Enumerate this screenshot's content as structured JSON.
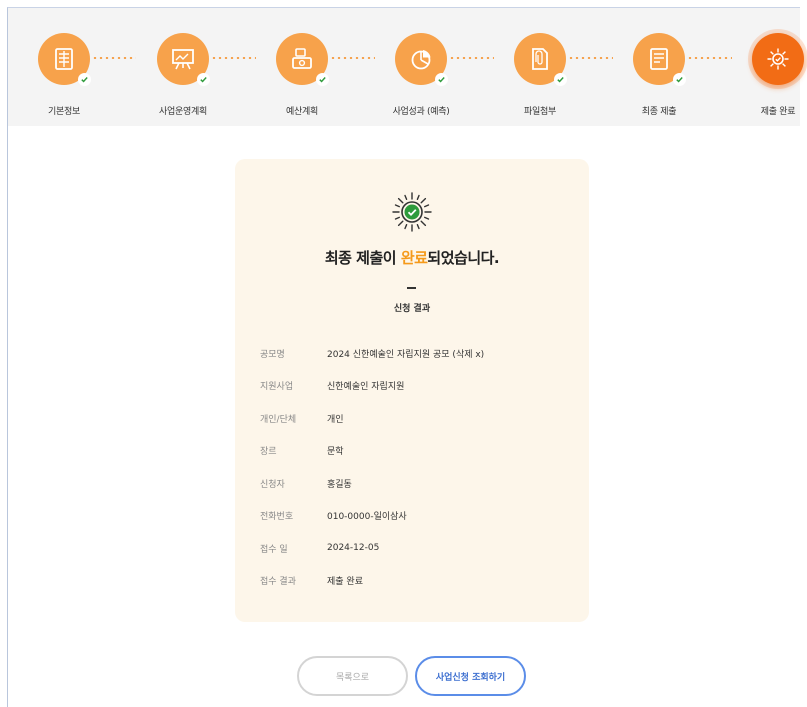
{
  "steps": [
    {
      "label": "기본정보",
      "icon": "form-grid-icon"
    },
    {
      "label": "사업운영계획",
      "icon": "presentation-board-icon"
    },
    {
      "label": "예산계획",
      "icon": "money-stack-icon"
    },
    {
      "label": "사업성과 (예측)",
      "icon": "pie-chart-icon"
    },
    {
      "label": "파일첨부",
      "icon": "paperclip-document-icon"
    },
    {
      "label": "최종 제출",
      "icon": "checklist-document-icon"
    },
    {
      "label": "제출 완료",
      "icon": "sunburst-check-icon"
    }
  ],
  "active_step": 7,
  "completion": {
    "title_before": "최종 제출이 ",
    "title_highlight": "완료",
    "title_after": "되었습니다.",
    "subtitle": "신청 결과"
  },
  "result": [
    {
      "label": "공모명",
      "value": "2024 신한예술인 자립지원 공모 (삭제 x)"
    },
    {
      "label": "지원사업",
      "value": "신한예술인 자립지원"
    },
    {
      "label": "개인/단체",
      "value": "개인"
    },
    {
      "label": "장르",
      "value": "문학"
    },
    {
      "label": "신청자",
      "value": "홍길동"
    },
    {
      "label": "전화번호",
      "value": "010-0000-일이삼사"
    },
    {
      "label": "접수 일",
      "value": "2024-12-05"
    },
    {
      "label": "접수 결과",
      "value": "제출 완료"
    }
  ],
  "buttons": {
    "list": "목록으로",
    "view": "사업신청 조회하기"
  },
  "colors": {
    "step_done": "#f7a24b",
    "step_active": "#f26c15",
    "highlight": "#f59a1b",
    "check_green": "#2e9b3c",
    "card_bg": "#fdf6ea",
    "primary_button": "#5b8de8"
  }
}
